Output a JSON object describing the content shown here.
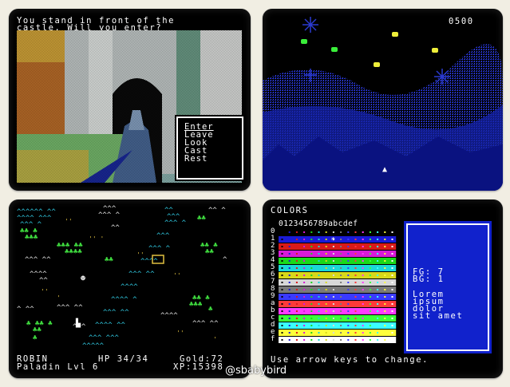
{
  "adventure": {
    "prompt_line1": "You stand in front of the",
    "prompt_line2": "castle. Will you enter?",
    "menu": [
      "Enter",
      "Leave",
      "Look",
      "Cast",
      "Rest"
    ],
    "selected": "Enter"
  },
  "shooter": {
    "score": "0500"
  },
  "overworld": {
    "name": "ROBIN",
    "hp_label": "HP 34/34",
    "gold_label": "Gold:72",
    "class_label": "Paladin Lvl 6",
    "xp_label": "XP:15398"
  },
  "colors_screen": {
    "title": "COLORS",
    "hex_header": "0123456789abcdef",
    "row_labels": [
      "0",
      "1",
      "2",
      "3",
      "4",
      "5",
      "6",
      "7",
      "8",
      "9",
      "a",
      "b",
      "c",
      "d",
      "e",
      "f"
    ],
    "row_colors": [
      "#000000",
      "#1a1ad8",
      "#d81a1a",
      "#d81ad8",
      "#1ad81a",
      "#1ad8d8",
      "#d8d81a",
      "#d8d8d8",
      "#7a7a7a",
      "#3a3aff",
      "#ff3a3a",
      "#ff3aff",
      "#3aff3a",
      "#3affff",
      "#ffff3a",
      "#ffffff"
    ],
    "fg_label": "FG: 7",
    "bg_label": "BG: 1",
    "sample_text": [
      "Lorem",
      "ipsum",
      "dolor",
      "sit amet"
    ],
    "hint": "Use arrow keys to change."
  },
  "watermark": "@sbabybird"
}
